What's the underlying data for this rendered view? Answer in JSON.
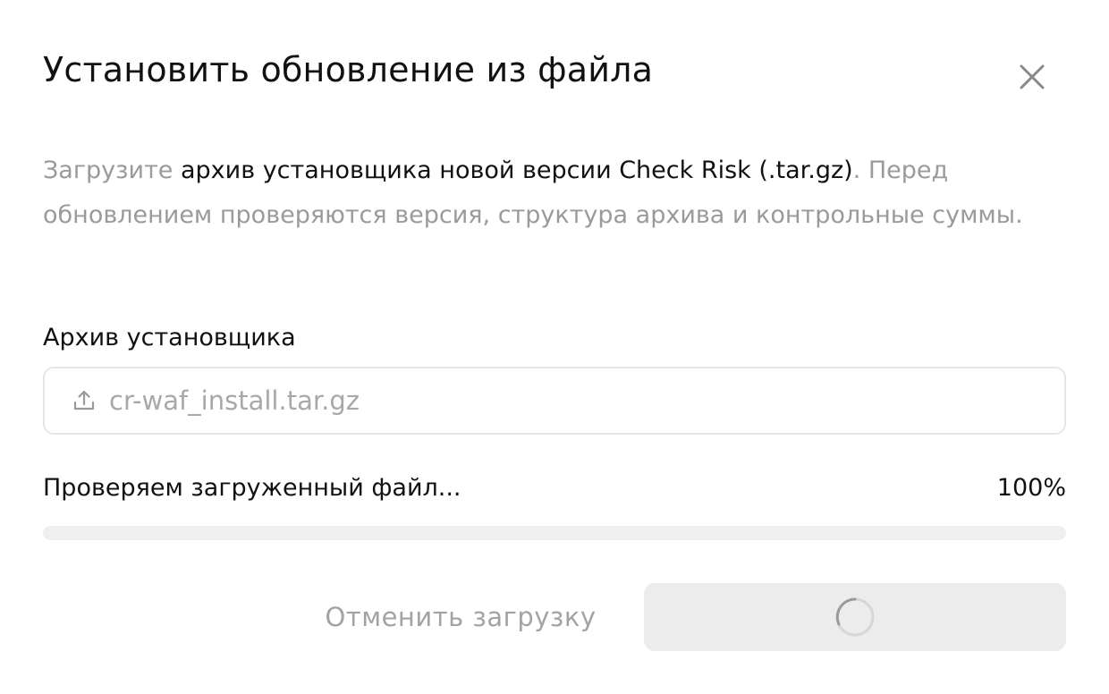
{
  "dialog": {
    "title": "Установить обновление из файла",
    "close_icon": "close-icon"
  },
  "description": {
    "part1": "Загрузите ",
    "highlight": "архив установщика новой версии Check Risk (.tar.gz)",
    "part2": ". Перед обновлением проверяются версия, структура архива и контрольные суммы."
  },
  "field": {
    "label": "Архив установщика",
    "file_name": "cr-waf_install.tar.gz",
    "icon": "upload-icon"
  },
  "progress": {
    "status_text": "Проверяем загруженный файл...",
    "percent_text": "100%",
    "value": 1.0
  },
  "actions": {
    "cancel_label": "Отменить загрузку",
    "submit_icon": "spinner-icon"
  },
  "colors": {
    "text_primary": "#111111",
    "text_muted": "#9a9a9a",
    "track": "#f0f0f1",
    "button_disabled_bg": "#ececec"
  }
}
